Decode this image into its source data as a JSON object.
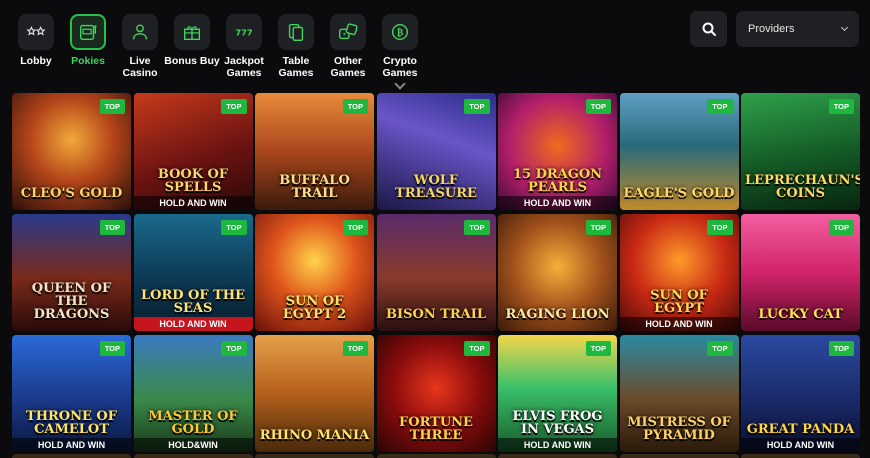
{
  "categories": [
    {
      "label": "Lobby",
      "icon": "stars-icon",
      "active": false
    },
    {
      "label": "Pokies",
      "icon": "slot-machine-icon",
      "active": true
    },
    {
      "label": "Live Casino",
      "icon": "dealer-icon",
      "active": false
    },
    {
      "label": "Bonus Buy",
      "icon": "gift-icon",
      "active": false
    },
    {
      "label": "Jackpot Games",
      "icon": "triple-seven-icon",
      "active": false
    },
    {
      "label": "Table Games",
      "icon": "cards-icon",
      "active": false
    },
    {
      "label": "Other Games",
      "icon": "dice-icon",
      "active": false
    },
    {
      "label": "Crypto Games",
      "icon": "bitcoin-icon",
      "active": false
    }
  ],
  "search": {
    "icon": "search-icon"
  },
  "providers": {
    "label": "Providers"
  },
  "badge_text": "TOP",
  "colors": {
    "accent": "#27c14a",
    "badge": "#1fb83f",
    "surface": "#1f2024",
    "background": "#0b0b0d"
  },
  "games": [
    {
      "title": "CLEO'S GOLD",
      "bg": "radial-gradient(circle at 50% 40%, #f3a93a 0%, #b5451a 45%, #2a0f0a 100%)",
      "title_color": "#f8d36a"
    },
    {
      "title": "BOOK OF SPELLS",
      "band": "HOLD AND WIN",
      "bg": "linear-gradient(160deg, #c73a1c 0%, #6e1412 55%, #2a0808 100%)",
      "title_color": "#ffd56a"
    },
    {
      "title": "BUFFALO TRAIL",
      "bg": "linear-gradient(180deg, #e78b3b 0%, #a9471c 50%, #3b1a0c 100%)",
      "title_color": "#ffe08a"
    },
    {
      "title": "WOLF TREASURE",
      "bg": "linear-gradient(200deg, #2a2d8a 0%, #6a55c9 40%, #1b1846 100%)",
      "title_color": "#f6d765"
    },
    {
      "title": "15 DRAGON PEARLS",
      "band": "HOLD AND WIN",
      "bg": "radial-gradient(circle at 50% 45%, #f16a1c 0%, #b31f6a 55%, #3a0a3a 100%)",
      "title_color": "#ffd24a"
    },
    {
      "title": "EAGLE'S GOLD",
      "bg": "linear-gradient(180deg, #5fa0c4 0%, #2a6a7a 45%, #c08a28 100%)",
      "title_color": "#ffd864"
    },
    {
      "title": "LEPRECHAUN'S COINS",
      "bg": "linear-gradient(170deg, #2fa14a 0%, #145a26 55%, #08260f 100%)",
      "title_color": "#ffd964"
    },
    {
      "title": "QUEEN OF THE DRAGONS",
      "bg": "linear-gradient(180deg, #2a3a8a 0%, #7a2a1a 55%, #2a0a0a 100%)",
      "title_color": "#f3e4c4"
    },
    {
      "title": "LORD OF THE SEAS",
      "band": "HOLD AND WIN",
      "bg": "linear-gradient(180deg, #1a6a8a 0%, #0e3d5a 50%, #081d2a 100%)",
      "title_color": "#ffe27a",
      "band_bg": "#c5161f"
    },
    {
      "title": "SUN OF EGYPT 2",
      "bg": "radial-gradient(circle at 50% 40%, #ffd34a 0%, #e0561c 45%, #6a0f0a 100%)",
      "title_color": "#ffe066"
    },
    {
      "title": "BISON TRAIL",
      "bg": "linear-gradient(180deg, #5a2a6a 0%, #8a3a2a 55%, #2a0f12 100%)",
      "title_color": "#ffd24a"
    },
    {
      "title": "RAGING LION",
      "bg": "radial-gradient(circle at 50% 45%, #f4b03a 0%, #a3521c 50%, #3a1a0a 100%)",
      "title_color": "#ffe8a0"
    },
    {
      "title": "SUN OF EGYPT",
      "band": "HOLD AND WIN",
      "bg": "radial-gradient(circle at 50% 40%, #ff9a2a 0%, #c92a14 50%, #4a0808 100%)",
      "title_color": "#ffd65a"
    },
    {
      "title": "LUCKY CAT",
      "bg": "linear-gradient(180deg, #f25fa0 0%, #d1236a 50%, #5a0a2a 100%)",
      "title_color": "#ffe14a"
    },
    {
      "title": "THRONE OF CAMELOT",
      "band": "HOLD AND WIN",
      "bg": "linear-gradient(180deg, #2a6ad8 0%, #1a3a8a 55%, #0a1840 100%)",
      "title_color": "#ffe46a"
    },
    {
      "title": "MASTER OF GOLD",
      "band": "HOLD&WIN",
      "bg": "linear-gradient(180deg, #3a7ac0 0%, #3a8a4a 55%, #1a3a1a 100%)",
      "title_color": "#ffc83a"
    },
    {
      "title": "RHINO MANIA",
      "bg": "linear-gradient(180deg, #e6a04a 0%, #b5601c 50%, #4a2a0a 100%)",
      "title_color": "#ffe26a"
    },
    {
      "title": "FORTUNE THREE",
      "bg": "radial-gradient(circle at 50% 45%, #e8361c 0%, #8a0c0c 50%, #2a0404 100%)",
      "title_color": "#ffd24a"
    },
    {
      "title": "ELVIS FROG IN VEGAS",
      "band": "HOLD AND WIN",
      "bg": "linear-gradient(180deg, #f4d64a 0%, #3ac06a 45%, #1a5a2a 100%)",
      "title_color": "#ffffff"
    },
    {
      "title": "MISTRESS OF PYRAMID",
      "bg": "linear-gradient(180deg, #2a8aa0 0%, #6a4a2a 55%, #2a1a0a 100%)",
      "title_color": "#ffd264"
    },
    {
      "title": "GREAT PANDA",
      "band": "HOLD AND WIN",
      "bg": "linear-gradient(180deg, #2a4aa0 0%, #1a2a6a 55%, #0a1030 100%)",
      "title_color": "#ffd64a"
    }
  ]
}
